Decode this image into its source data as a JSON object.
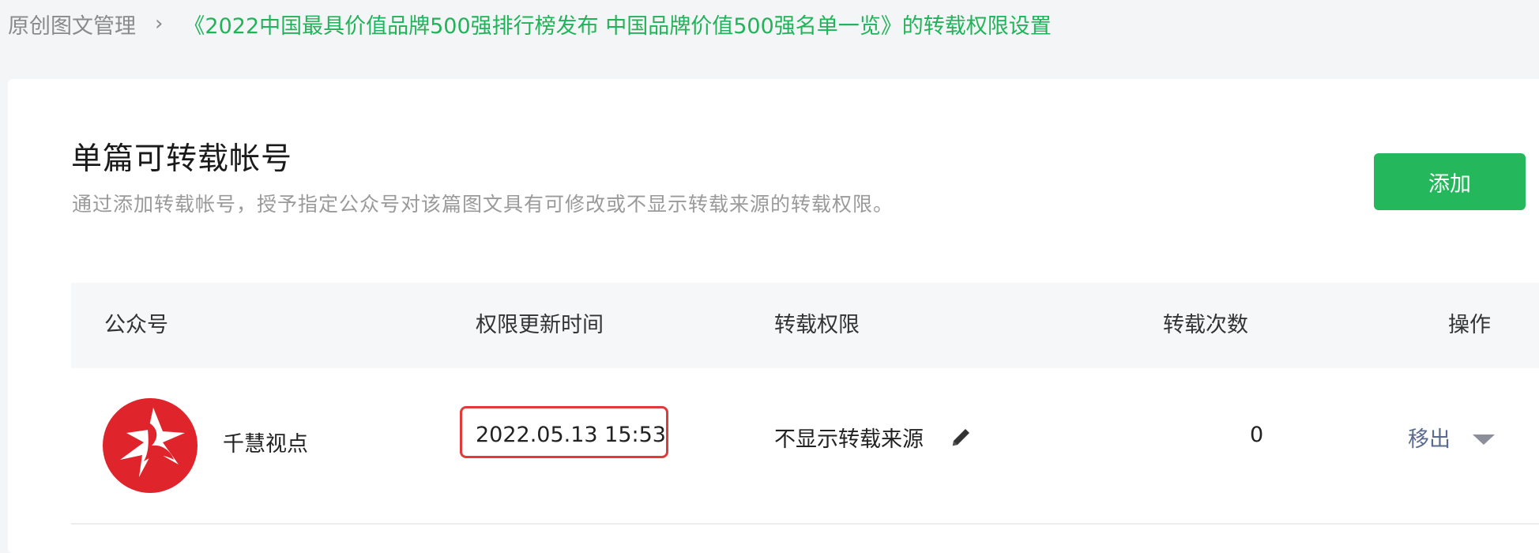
{
  "breadcrumb": {
    "root": "原创图文管理",
    "separator": "›",
    "current": "《2022中国最具价值品牌500强排行榜发布 中国品牌价值500强名单一览》的转载权限设置"
  },
  "section": {
    "title": "单篇可转载帐号",
    "description": "通过添加转载帐号，授予指定公众号对该篇图文具有可修改或不显示转载来源的转载权限。",
    "add_button": "添加"
  },
  "table": {
    "columns": [
      "公众号",
      "权限更新时间",
      "转载权限",
      "转载次数",
      "操作"
    ],
    "rows": [
      {
        "account": "千慧视点",
        "updated_time": "2022.05.13 15:53",
        "permission": "不显示转载来源",
        "count": "0",
        "action": "移出"
      }
    ]
  },
  "colors": {
    "accent_green": "#24b75b",
    "highlight_red": "#e23a3a",
    "avatar_red": "#e0242c",
    "link_blue": "#5a6b8c"
  },
  "icons": {
    "edit": "pencil-icon",
    "dropdown": "caret-down-icon",
    "breadcrumb_separator": "chevron-right-icon"
  }
}
